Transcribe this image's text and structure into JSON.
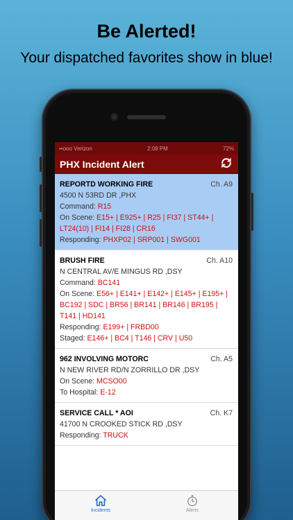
{
  "promo": {
    "headline": "Be Alerted!",
    "subline": "Your dispatched favorites show in blue!"
  },
  "status_bar": {
    "carrier": "••ooo Verizon",
    "time": "2:08 PM",
    "battery": "72%"
  },
  "app": {
    "title": "PHX Incident Alert",
    "refresh_icon": "refresh-icon"
  },
  "incidents": [
    {
      "title": "REPORTD WORKING FIRE",
      "channel": "Ch. A9",
      "address": "4500 N 53RD DR ,PHX",
      "dispatched_favorite": true,
      "command_label": "Command:",
      "command": "R15",
      "on_scene_label": "On Scene:",
      "on_scene": "E15+ | E925+ | R25 | FI37 | ST44+ | LT24(10) | FI14 | FI28 | CR16",
      "responding_label": "Responding:",
      "responding": "PHXP02 | SRP001 | SWG001"
    },
    {
      "title": "BRUSH FIRE",
      "channel": "Ch. A10",
      "address": "N CENTRAL AV/E MINGUS RD ,DSY",
      "dispatched_favorite": false,
      "command_label": "Command:",
      "command": "BC141",
      "on_scene_label": "On Scene:",
      "on_scene": "E56+ | E141+ | E142+ | E145+ | E195+ | BC192 | SDC | BR56 | BR141 | BR146 | BR195 | T141 | HD141",
      "responding_label": "Responding:",
      "responding": "E199+ | FRBD00",
      "staged_label": "Staged:",
      "staged": "E146+ | BC4 | T146 | CRV | U50"
    },
    {
      "title": "962 INVOLVING MOTORC",
      "channel": "Ch. A5",
      "address": "N NEW RIVER RD/N ZORRILLO DR ,DSY",
      "dispatched_favorite": false,
      "on_scene_label": "On Scene:",
      "on_scene": "MCSO00",
      "hospital_label": "To Hospital:",
      "hospital": "E-12"
    },
    {
      "title": "SERVICE CALL * AOI",
      "channel": "Ch. K7",
      "address": "41700 N CROOKED STICK RD ,DSY",
      "dispatched_favorite": false,
      "responding_label": "Responding:",
      "responding": "TRUCK"
    }
  ],
  "tabs": [
    {
      "label": "Incidents",
      "icon": "home-icon",
      "active": true
    },
    {
      "label": "Alerts",
      "icon": "stopwatch-icon",
      "active": false
    }
  ],
  "colors": {
    "nav_bar": "#7d0b0b",
    "dispatched_highlight": "#a9ccf4",
    "unit_text": "#d01010",
    "active_tab": "#1b6fe0"
  }
}
